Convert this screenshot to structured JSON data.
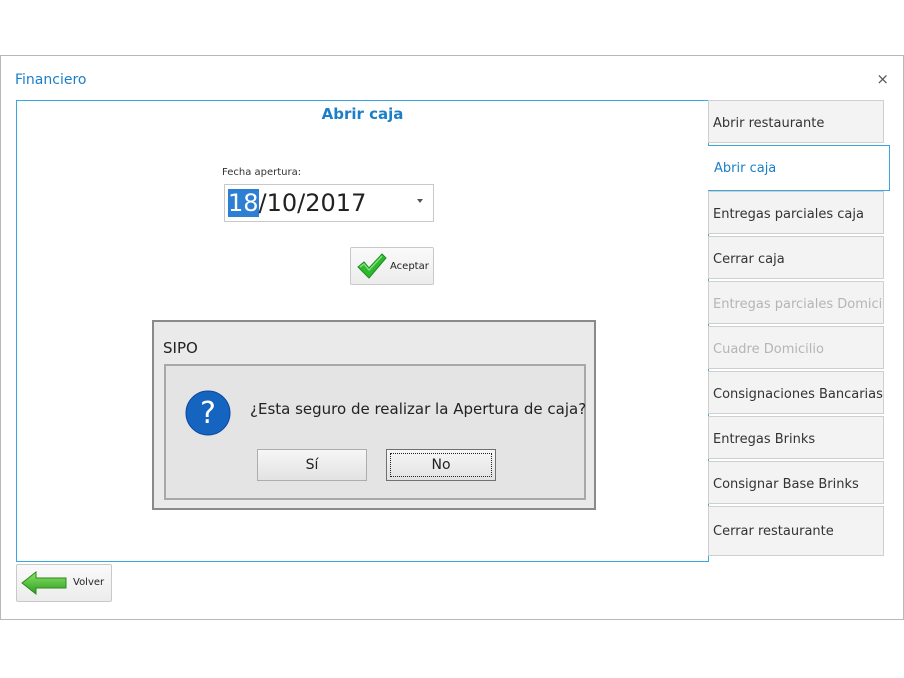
{
  "window": {
    "title": "Financiero",
    "close_glyph": "×"
  },
  "main": {
    "title": "Abrir caja",
    "date_label": "Fecha apertura:",
    "date_selected_part": "18",
    "date_rest": "/10/2017",
    "accept_label": "Aceptar"
  },
  "sidebar": {
    "items": [
      {
        "label": "Abrir restaurante",
        "state": "normal"
      },
      {
        "label": "Abrir caja",
        "state": "active"
      },
      {
        "label": "Entregas parciales caja",
        "state": "normal"
      },
      {
        "label": "Cerrar caja",
        "state": "normal"
      },
      {
        "label": "Entregas parciales Domicilio",
        "state": "disabled"
      },
      {
        "label": "Cuadre Domicilio",
        "state": "disabled"
      },
      {
        "label": "Consignaciones Bancarias",
        "state": "normal"
      },
      {
        "label": "Entregas Brinks",
        "state": "normal"
      },
      {
        "label": "Consignar Base Brinks",
        "state": "normal"
      },
      {
        "label": "Cerrar restaurante",
        "state": "normal"
      }
    ]
  },
  "back_button": {
    "label": "Volver"
  },
  "dialog": {
    "title": "SIPO",
    "message": "¿Esta seguro de realizar la Apertura de caja?",
    "yes_label": "Sí",
    "no_label": "No"
  },
  "colors": {
    "accent": "#1a7fc8",
    "panel_border": "#3aa8de",
    "check_green": "#2eb82e",
    "question_blue": "#1565c0"
  },
  "icons": {
    "accept": "checkmark-icon",
    "back": "arrow-left-icon",
    "dialog": "question-icon",
    "close": "close-icon",
    "dropdown": "chevron-down-icon"
  }
}
